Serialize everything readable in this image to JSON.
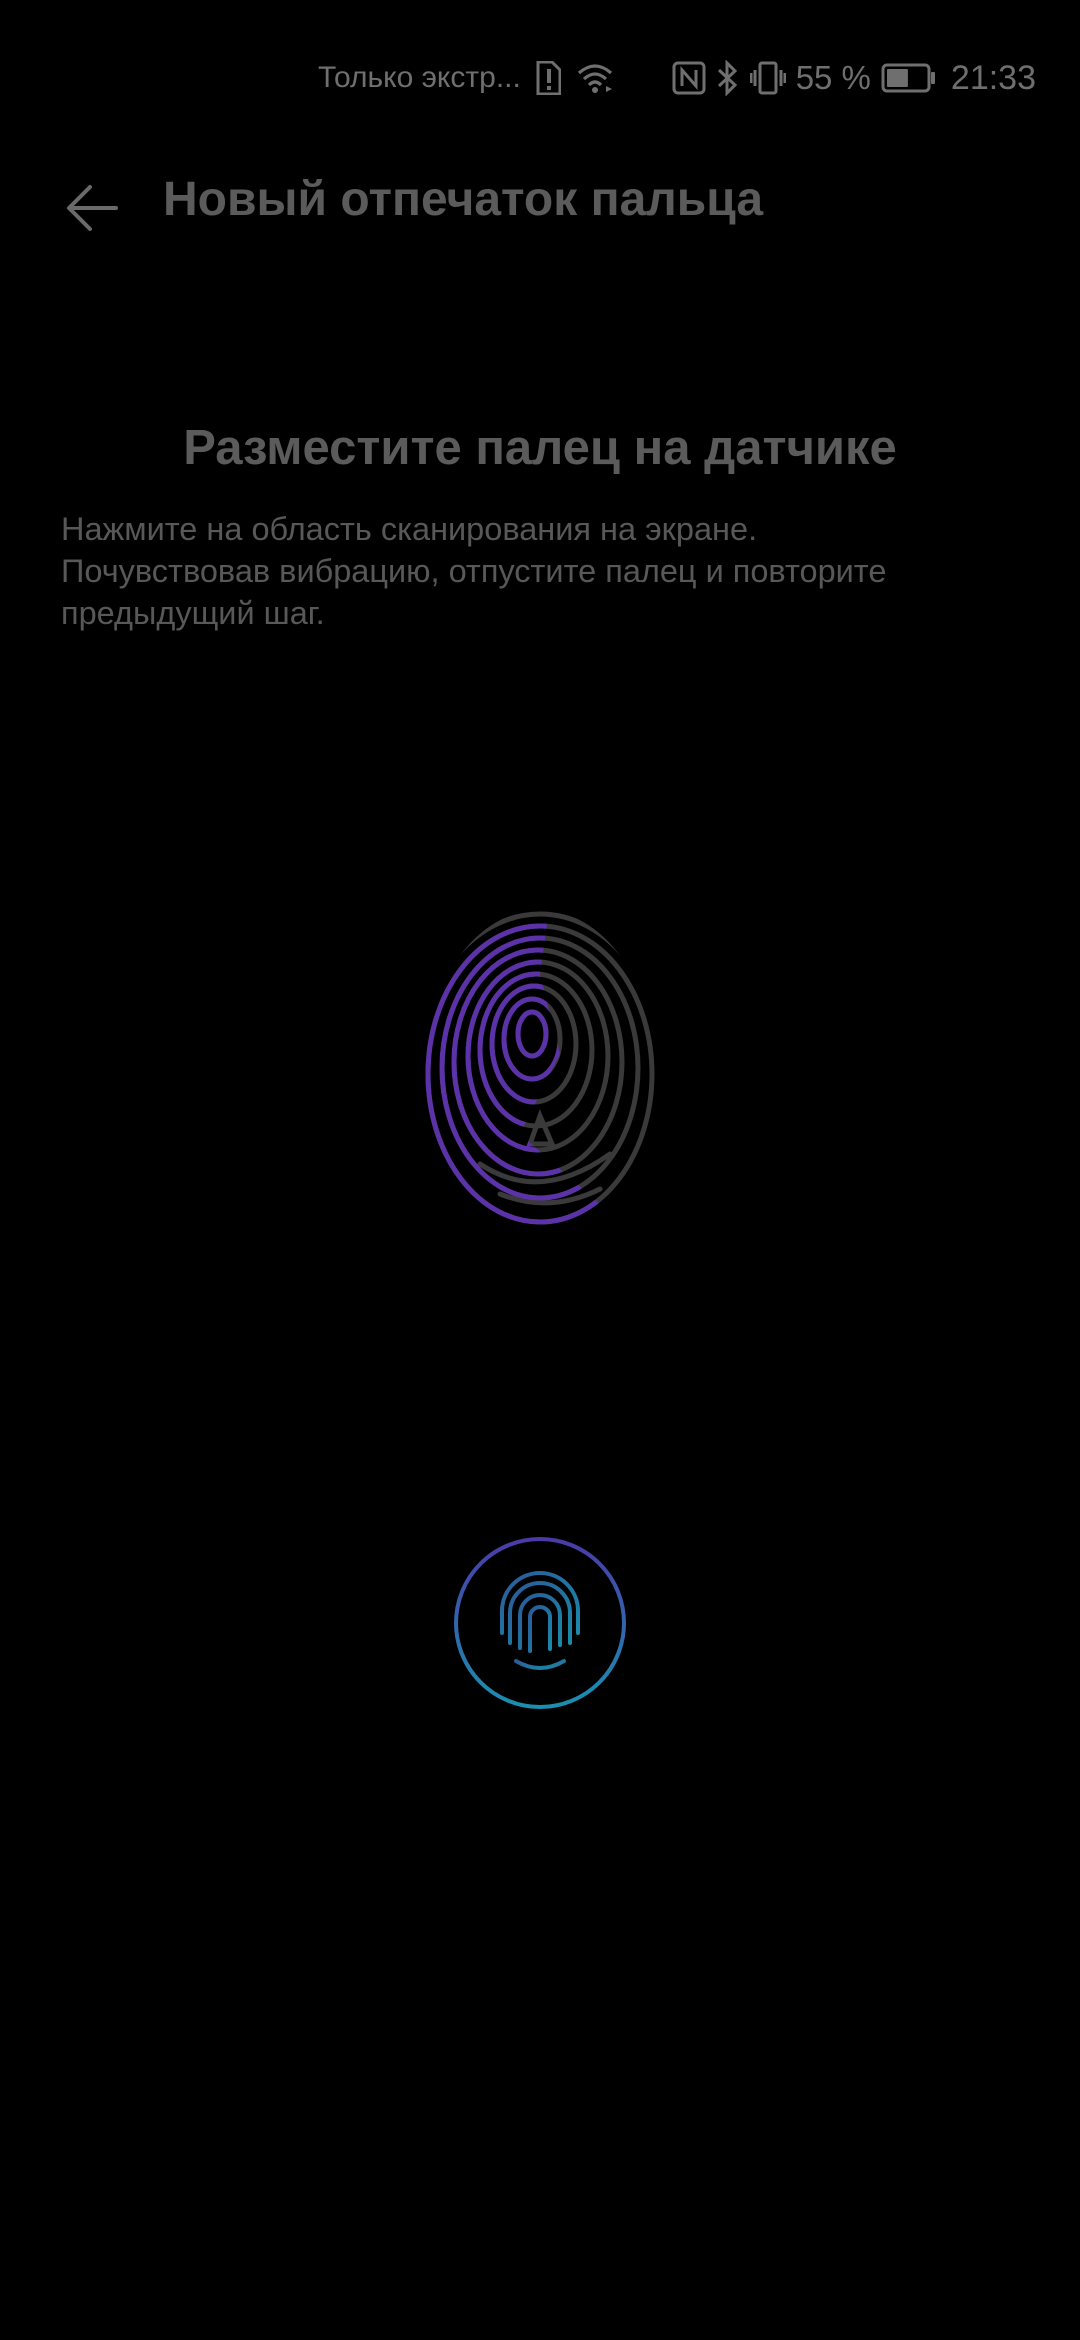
{
  "status_bar": {
    "network_text": "Только экстр...",
    "battery_percent": "55 %",
    "time": "21:33",
    "battery_level": 0.55,
    "icons": [
      "sim-alert-icon",
      "wifi-icon",
      "nfc-icon",
      "bluetooth-icon",
      "vibrate-icon",
      "battery-icon"
    ]
  },
  "app_bar": {
    "title": "Новый отпечаток пальца",
    "back_icon": "arrow-left-icon"
  },
  "instructions": {
    "title": "Разместите палец на датчике",
    "line1": "Нажмите на область сканирования на экране.",
    "line2": "Почувствовав вибрацию, отпустите палец и повторите",
    "line3": "предыдущий шаг."
  },
  "fingerprint": {
    "icon": "fingerprint-icon",
    "enroll_progress_color": "#6a3fb8",
    "base_color": "#3a3a3a"
  },
  "sensor": {
    "icon": "fingerprint-sensor-icon",
    "ring_color_top": "#4a3aa8",
    "ring_color_bottom": "#1a8fb0"
  }
}
